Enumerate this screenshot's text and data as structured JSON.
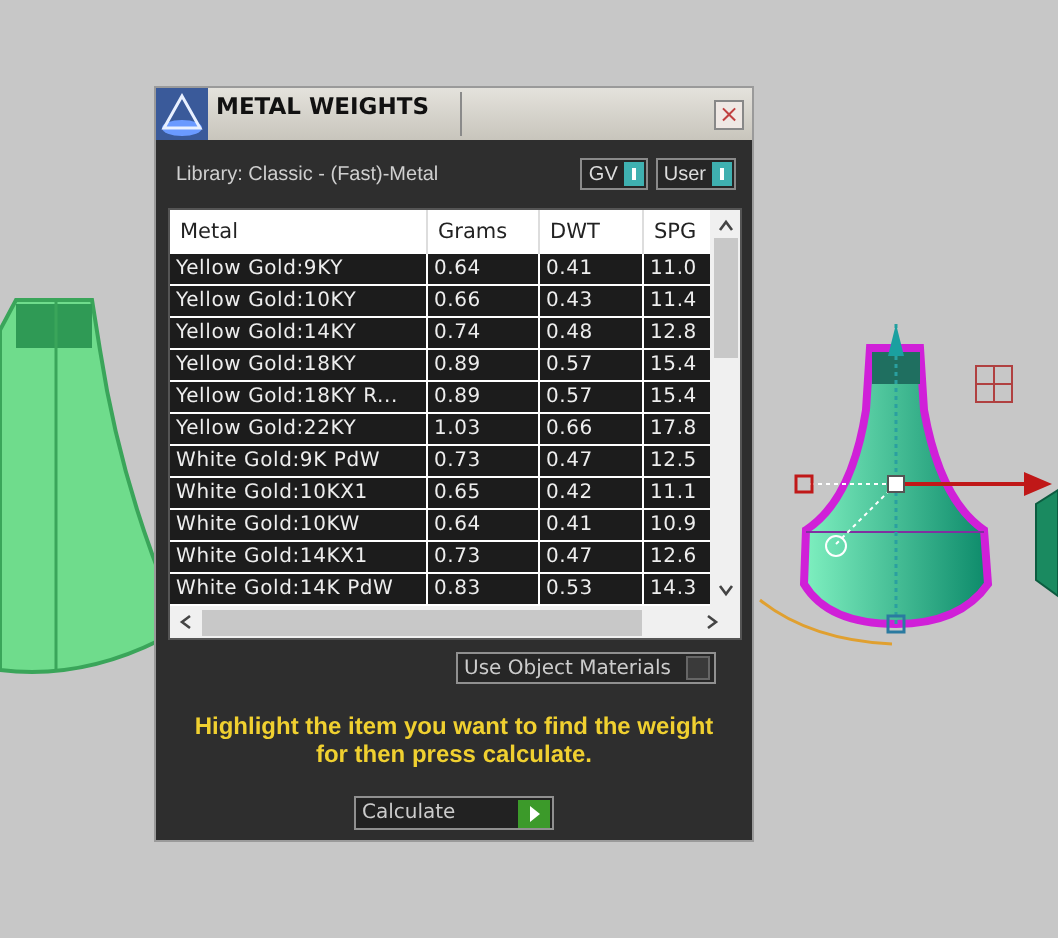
{
  "window": {
    "title": "METAL WEIGHTS",
    "close": "×"
  },
  "library": "Library: Classic - (Fast)-Metal",
  "toggles": [
    {
      "label": "GV",
      "on": true
    },
    {
      "label": "User",
      "on": true
    }
  ],
  "table": {
    "columns": [
      "Metal",
      "Grams",
      "DWT",
      "SPG"
    ],
    "rows": [
      [
        "Yellow Gold:9KY",
        "0.64",
        "0.41",
        "11.0"
      ],
      [
        "Yellow Gold:10KY",
        "0.66",
        "0.43",
        "11.4"
      ],
      [
        "Yellow Gold:14KY",
        "0.74",
        "0.48",
        "12.8"
      ],
      [
        "Yellow Gold:18KY",
        "0.89",
        "0.57",
        "15.4"
      ],
      [
        "Yellow Gold:18KY R...",
        "0.89",
        "0.57",
        "15.4"
      ],
      [
        "Yellow Gold:22KY",
        "1.03",
        "0.66",
        "17.8"
      ],
      [
        "White Gold:9K PdW",
        "0.73",
        "0.47",
        "12.5"
      ],
      [
        "White Gold:10KX1",
        "0.65",
        "0.42",
        "11.1"
      ],
      [
        "White Gold:10KW",
        "0.64",
        "0.41",
        "10.9"
      ],
      [
        "White Gold:14KX1",
        "0.73",
        "0.47",
        "12.6"
      ],
      [
        "White Gold:14K PdW",
        "0.83",
        "0.53",
        "14.3"
      ]
    ]
  },
  "use_object_materials": {
    "label": "Use Object Materials",
    "checked": false
  },
  "hint": "Highlight the item you want to find the weight for then press calculate.",
  "calculate": {
    "label": "Calculate"
  }
}
